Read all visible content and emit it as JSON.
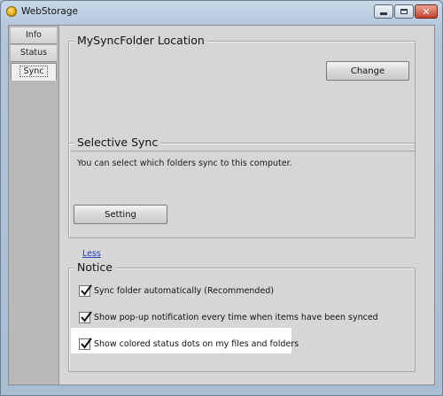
{
  "window": {
    "title": "WebStorage"
  },
  "tabs": [
    {
      "label": "Info"
    },
    {
      "label": "Status"
    },
    {
      "label": "Sync",
      "selected": true
    }
  ],
  "mysyncfolder": {
    "legend": "MySyncFolder Location",
    "change_label": "Change"
  },
  "selective_sync": {
    "legend": "Selective Sync",
    "description": "You can select which folders sync to this computer.",
    "setting_label": "Setting"
  },
  "less_link": "Less",
  "notice": {
    "legend": "Notice",
    "options": [
      {
        "label": "Sync folder automatically (Recommended)",
        "checked": true
      },
      {
        "label": "Show pop-up notification every time when items have been synced",
        "checked": true
      },
      {
        "label": "Show colored status dots on my files and folders",
        "checked": true
      }
    ]
  },
  "icons": {
    "app": "webstorage-icon",
    "minimize": "minimize-icon",
    "maximize": "maximize-icon",
    "close": "close-icon",
    "check": "checkmark-icon"
  },
  "colors": {
    "link": "#1f3fb3",
    "highlight": "#ffffff",
    "close_button": "#c2412a"
  }
}
